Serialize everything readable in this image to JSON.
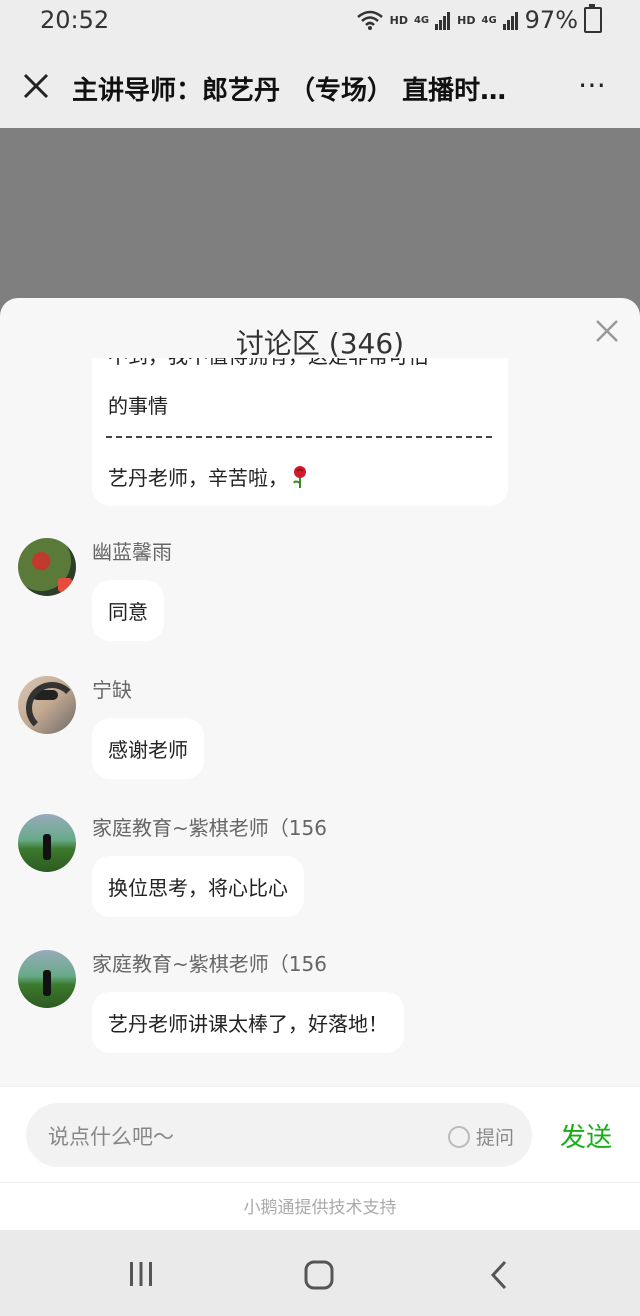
{
  "status_bar": {
    "time": "20:52",
    "battery": "97%",
    "hd1": "HD",
    "hd2": "HD",
    "net1": "4G",
    "net2": "4G"
  },
  "header": {
    "title": "主讲导师：郎艺丹 （专场） 直播时…",
    "more": "⋯"
  },
  "discussion": {
    "title": "讨论区 (346)",
    "partial_message": {
      "line1": "不到，我不值得拥有，这是非常可怕",
      "line2": "的事情",
      "line3": "艺丹老师，辛苦啦，"
    },
    "messages": [
      {
        "name": "幽蓝馨雨",
        "text": "同意"
      },
      {
        "name": "宁缺",
        "text": "感谢老师"
      },
      {
        "name": "家庭教育~紫棋老师（156",
        "text": "换位思考，将心比心"
      },
      {
        "name": "家庭教育~紫棋老师（156",
        "text": "艺丹老师讲课太棒了，好落地！"
      }
    ]
  },
  "input": {
    "placeholder": "说点什么吧～",
    "ask_label": "提问",
    "send_label": "发送"
  },
  "footer": {
    "support": "小鹅通提供技术支持"
  },
  "colors": {
    "accent": "#1aad19",
    "video_bg": "#7f7f7f",
    "panel_bg": "#f7f7f7"
  },
  "icons": [
    "close-icon",
    "more-icon",
    "rose-icon",
    "recent-apps-icon",
    "home-icon",
    "back-icon"
  ]
}
